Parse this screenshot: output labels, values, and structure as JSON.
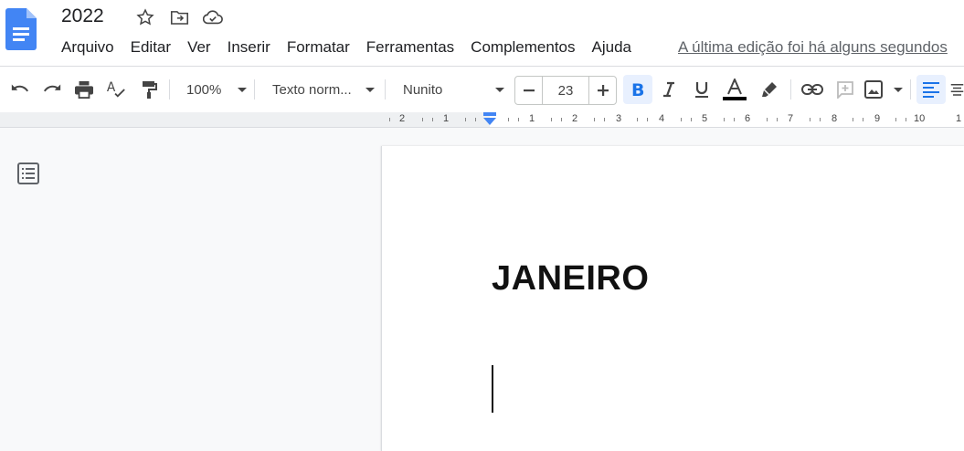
{
  "app": {
    "title": "2022",
    "last_edit": "A última edição foi há alguns segundos"
  },
  "menu": [
    "Arquivo",
    "Editar",
    "Ver",
    "Inserir",
    "Formatar",
    "Ferramentas",
    "Complementos",
    "Ajuda"
  ],
  "toolbar": {
    "zoom": "100%",
    "style": "Texto norm...",
    "font": "Nunito",
    "font_size": "23"
  },
  "ruler": {
    "labels": [
      "2",
      "1",
      "1",
      "2",
      "3",
      "4",
      "5",
      "6",
      "7",
      "8",
      "9",
      "10",
      "1"
    ]
  },
  "document": {
    "heading": "JANEIRO"
  },
  "colors": {
    "accent": "#1a73e8",
    "doc_icon": "#4285f4",
    "active_button_bg": "#e8f0fe"
  },
  "icons": [
    "docs-logo-icon",
    "star-icon",
    "move-folder-icon",
    "cloud-saved-icon",
    "undo-icon",
    "redo-icon",
    "print-icon",
    "spellcheck-icon",
    "paint-format-icon",
    "bold-icon",
    "italic-icon",
    "underline-icon",
    "text-color-icon",
    "highlight-icon",
    "link-icon",
    "comment-icon",
    "image-icon",
    "align-left-icon",
    "align-center-icon",
    "document-outline-icon"
  ]
}
